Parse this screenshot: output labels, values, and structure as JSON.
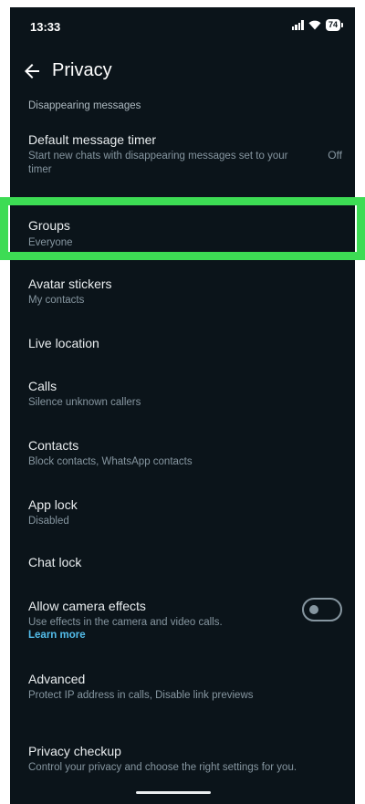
{
  "status": {
    "time": "13:33",
    "battery": "74"
  },
  "appbar": {
    "title": "Privacy"
  },
  "section": {
    "disappearing_header": "Disappearing messages"
  },
  "rows": {
    "default_timer": {
      "title": "Default message timer",
      "sub": "Start new chats with disappearing messages set to your timer",
      "value": "Off"
    },
    "groups": {
      "title": "Groups",
      "sub": "Everyone"
    },
    "avatar": {
      "title": "Avatar stickers",
      "sub": "My contacts"
    },
    "live_location": {
      "title": "Live location"
    },
    "calls": {
      "title": "Calls",
      "sub": "Silence unknown callers"
    },
    "contacts": {
      "title": "Contacts",
      "sub": "Block contacts, WhatsApp contacts"
    },
    "app_lock": {
      "title": "App lock",
      "sub": "Disabled"
    },
    "chat_lock": {
      "title": "Chat lock"
    },
    "camera_effects": {
      "title": "Allow camera effects",
      "sub": "Use effects in the camera and video calls.",
      "link": "Learn more",
      "toggle_on": false
    },
    "advanced": {
      "title": "Advanced",
      "sub": "Protect IP address in calls, Disable link previews"
    },
    "privacy_checkup": {
      "title": "Privacy checkup",
      "sub": "Control your privacy and choose the right settings for you."
    }
  },
  "colors": {
    "background": "#0b141a",
    "highlight": "#3ddc54",
    "link": "#53bdeb"
  }
}
